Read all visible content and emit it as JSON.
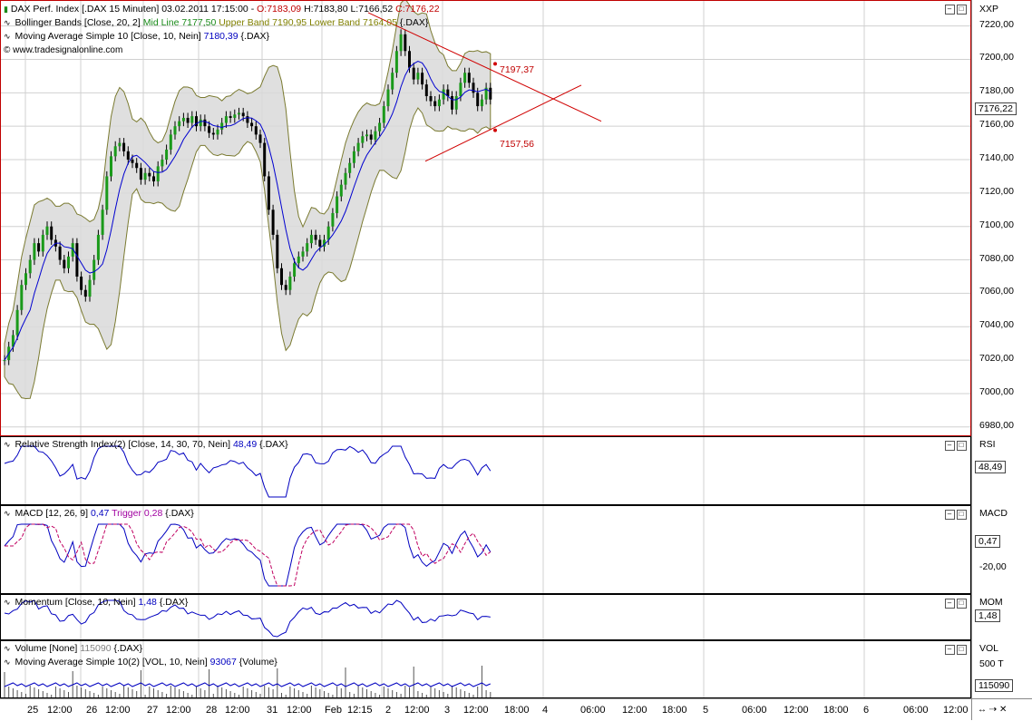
{
  "main": {
    "title": "DAX Perf. Index [.DAX  15 Minuten] 03.02.2011 17:15:00",
    "open": "O:7183,09",
    "high": "H:7183,80",
    "low": "L:7166,52",
    "close": "C:7176,22",
    "bb_label": "Bollinger Bands [Close, 20, 2]",
    "bb_mid": "Mid Line 7177,50",
    "bb_upper": "Upper Band 7190,95",
    "bb_lower": "Lower Band 7164,05",
    "bb_suffix": "{.DAX}",
    "ma_label": "Moving Average Simple 10 [Close, 10, Nein]",
    "ma_value": "7180,39",
    "ma_suffix": "{.DAX}",
    "copyright": "© www.tradesignalonline.com",
    "axis_name": "XXP",
    "current_price": "7176,22",
    "triangle_upper": "7197,37",
    "triangle_lower": "7157,56",
    "price_ticks": [
      "7220,00",
      "7200,00",
      "7180,00",
      "7160,00",
      "7140,00",
      "7120,00",
      "7100,00",
      "7080,00",
      "7060,00",
      "7040,00",
      "7020,00",
      "7000,00",
      "6980,00"
    ]
  },
  "rsi": {
    "label": "Relative Strength Index(2) [Close, 14, 30, 70, Nein]",
    "value": "48,49",
    "suffix": "{.DAX}",
    "axis_name": "RSI",
    "box": "48,49"
  },
  "macd": {
    "label": "MACD [12, 26, 9]",
    "value": "0,47",
    "trigger": "Trigger 0,28",
    "suffix": "{.DAX}",
    "axis_name": "MACD",
    "box": "0,47",
    "tick": "-20,00"
  },
  "mom": {
    "label": "Momentum [Close, 10, Nein]",
    "value": "1,48",
    "suffix": "{.DAX}",
    "axis_name": "MOM",
    "box": "1,48"
  },
  "vol": {
    "label": "Volume [None]",
    "value": "115090",
    "suffix": "{.DAX}",
    "ma_label": "Moving Average Simple 10(2) [VOL, 10, Nein]",
    "ma_value": "93067",
    "ma_suffix": "{Volume}",
    "axis_name": "VOL",
    "tick": "500 T",
    "box": "115090"
  },
  "time_labels": [
    "25",
    "12:00",
    "26",
    "12:00",
    "27",
    "12:00",
    "28",
    "12:00",
    "31",
    "12:00",
    "Feb",
    "12:15",
    "2",
    "12:00",
    "3",
    "12:00",
    "18:00",
    "4",
    "06:00",
    "12:00",
    "18:00",
    "5",
    "06:00",
    "12:00",
    "18:00",
    "6",
    "06:00",
    "12:00"
  ],
  "chart_data": {
    "type": "line",
    "title": "DAX Perf. Index [.DAX  15 Minuten]",
    "ylim": [
      6975,
      7235
    ],
    "close_series": [
      7020,
      7028,
      7035,
      7050,
      7065,
      7072,
      7080,
      7090,
      7085,
      7095,
      7100,
      7092,
      7088,
      7080,
      7075,
      7082,
      7090,
      7070,
      7062,
      7058,
      7068,
      7080,
      7095,
      7110,
      7130,
      7142,
      7148,
      7150,
      7145,
      7140,
      7138,
      7135,
      7128,
      7132,
      7130,
      7127,
      7136,
      7140,
      7146,
      7155,
      7160,
      7163,
      7165,
      7162,
      7166,
      7160,
      7164,
      7160,
      7156,
      7155,
      7158,
      7162,
      7166,
      7165,
      7167,
      7168,
      7166,
      7162,
      7160,
      7155,
      7150,
      7130,
      7110,
      7095,
      7075,
      7065,
      7062,
      7070,
      7078,
      7082,
      7085,
      7090,
      7095,
      7092,
      7088,
      7092,
      7100,
      7108,
      7118,
      7125,
      7132,
      7138,
      7145,
      7150,
      7154,
      7155,
      7152,
      7157,
      7162,
      7172,
      7182,
      7192,
      7205,
      7215,
      7205,
      7195,
      7188,
      7192,
      7185,
      7178,
      7175,
      7172,
      7176,
      7182,
      7178,
      7170,
      7178,
      7186,
      7192,
      7186,
      7180,
      7172,
      7176,
      7183,
      7176
    ],
    "triangle_upper_value": 7197.37,
    "triangle_lower_value": 7157.56
  }
}
